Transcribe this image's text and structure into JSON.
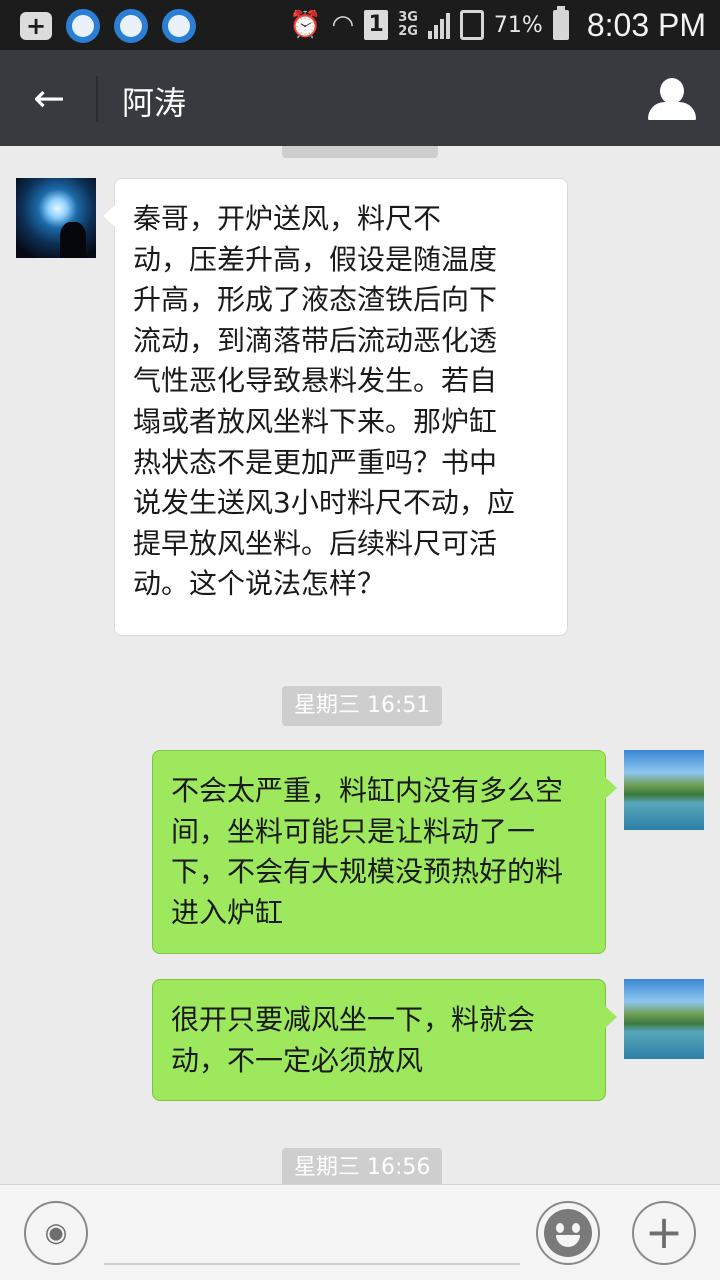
{
  "status_bar": {
    "sim_slot": "1",
    "network_top": "3G",
    "network_bottom": "2G",
    "battery_percent": "71%",
    "time": "8:03 PM",
    "icons": [
      "plus-box-icon",
      "qq-icon",
      "qq-icon",
      "qq-icon",
      "alarm-icon",
      "wifi-icon",
      "sim-icon",
      "signal-icon",
      "sd-card-icon",
      "battery-icon"
    ]
  },
  "header": {
    "back_icon": "←",
    "title": "阿涛",
    "profile_icon": "person-icon"
  },
  "chat": {
    "timestamps": [
      "星期三 16:51",
      "星期三 16:56"
    ],
    "messages": [
      {
        "direction": "incoming",
        "lines": [
          "秦哥，开炉送风，料尺不",
          "动，压差升高，假设是随温度",
          "升高，形成了液态渣铁后向下",
          "流动，到滴落带后流动恶化透",
          "气性恶化导致悬料发生。若自",
          "塌或者放风坐料下来。那炉缸",
          "热状态不是更加严重吗？书中",
          "说发生送风3小时料尺不动，应",
          "提早放风坐料。后续料尺可活",
          "动。这个说法怎样？"
        ]
      },
      {
        "direction": "outgoing",
        "lines": [
          "不会太严重，料缸内没有多么空",
          "间，坐料可能只是让料动了一",
          "下，不会有大规模没预热好的料",
          "进入炉缸"
        ]
      },
      {
        "direction": "outgoing",
        "lines": [
          "很开只要减风坐一下，料就会",
          "动，不一定必须放风"
        ]
      }
    ]
  },
  "input_bar": {
    "voice_icon": "voice-icon",
    "voice_glyph": "◉",
    "text_value": "",
    "emoji_icon": "emoji-icon",
    "more_icon": "plus-icon",
    "more_glyph": "+"
  },
  "colors": {
    "title_bar": "#393a3f",
    "chat_background": "#ebebeb",
    "incoming_bubble": "#ffffff",
    "outgoing_bubble": "#9ee85e",
    "timestamp_pill": "#cecece"
  }
}
